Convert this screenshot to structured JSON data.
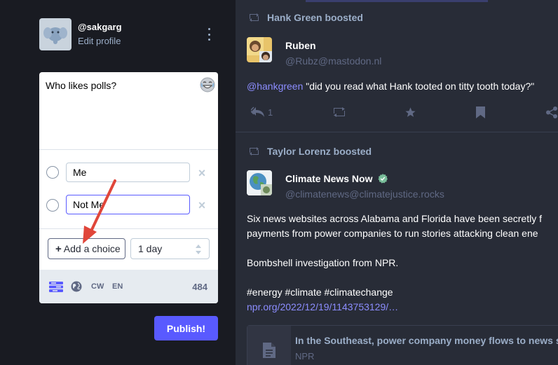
{
  "account": {
    "handle": "@sakgarg",
    "edit_profile": "Edit profile"
  },
  "composer": {
    "text": "Who likes polls?",
    "poll": {
      "choices": [
        {
          "value": "Me"
        },
        {
          "value": "Not Me"
        }
      ],
      "add_choice_label": "Add a choice",
      "duration": "1 day"
    },
    "toolbar": {
      "cw_label": "CW",
      "language": "EN",
      "char_count": "484"
    },
    "publish_label": "Publish!"
  },
  "timeline": [
    {
      "boosted_by": "Hank Green boosted",
      "author_name": "Ruben",
      "author_handle": "@Rubz@mastodon.nl",
      "mention": "@hankgreen",
      "text": " \"did you read what Hank tooted on titty tooth today?\"",
      "reply_count": "1"
    },
    {
      "boosted_by": "Taylor Lorenz boosted",
      "author_name": "Climate News Now",
      "author_handle": "@climatenews@climatejustice.rocks",
      "paragraphs": [
        "Six news websites across Alabama and Florida have been secretly f",
        "payments from power companies to run stories attacking clean ene",
        "Bombshell investigation from NPR.",
        "#energy #climate #climatechange"
      ],
      "link": "npr.org/2022/12/19/1143753129/…",
      "card_title": "In the Southeast, power company money flows to news sites",
      "card_source": "NPR"
    }
  ],
  "colors": {
    "accent": "#595aff",
    "annotation_arrow": "#e0463a",
    "verified_badge": "#79bd9a"
  }
}
